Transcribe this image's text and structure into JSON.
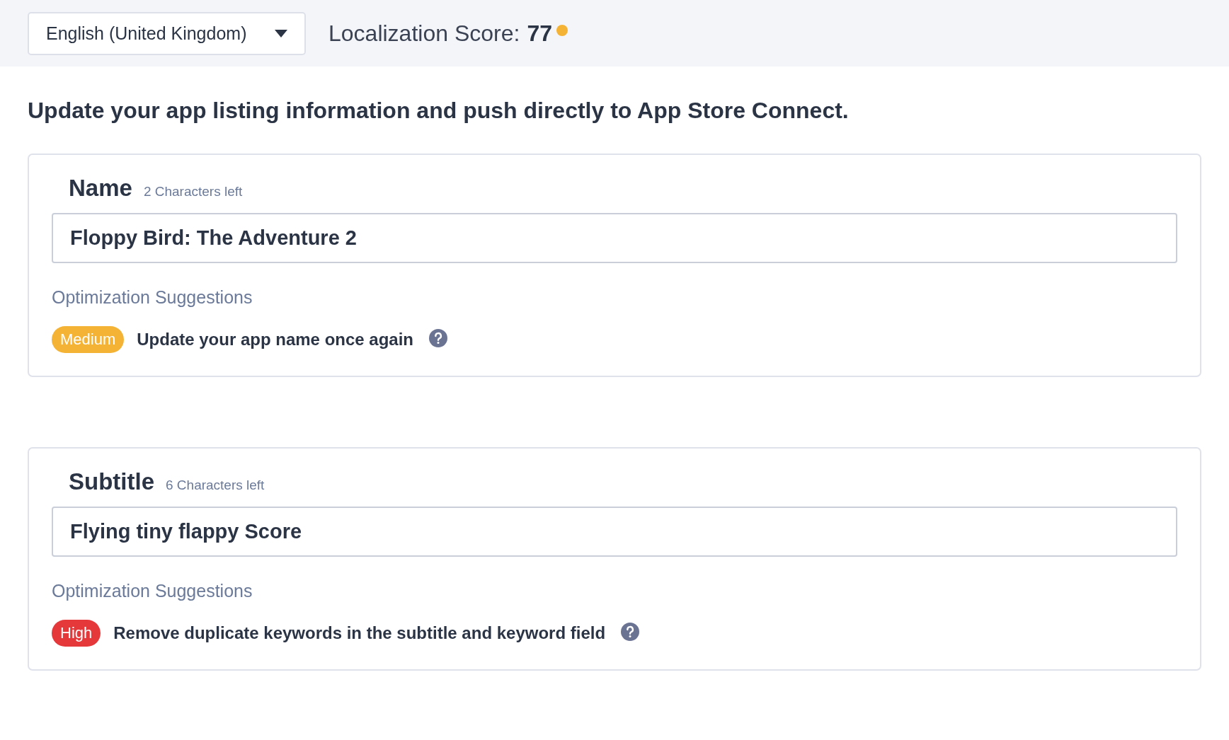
{
  "language_select": {
    "value": "English (United Kingdom)"
  },
  "score": {
    "label": "Localization Score:",
    "value": "77",
    "color": "#f5b335"
  },
  "heading": "Update your app listing information and push directly to App Store Connect.",
  "sections": [
    {
      "label": "Name",
      "hint": "2 Characters left",
      "value": "Floppy Bird: The Adventure 2",
      "suggestions_title": "Optimization Suggestions",
      "suggestions": [
        {
          "priority": "Medium",
          "color": "#f5b335",
          "text": "Update your app name once again"
        }
      ]
    },
    {
      "label": "Subtitle",
      "hint": "6 Characters left",
      "value": "Flying tiny flappy Score",
      "suggestions_title": "Optimization Suggestions",
      "suggestions": [
        {
          "priority": "High",
          "color": "#e5383b",
          "text": "Remove duplicate keywords in the subtitle and keyword field"
        }
      ]
    }
  ]
}
